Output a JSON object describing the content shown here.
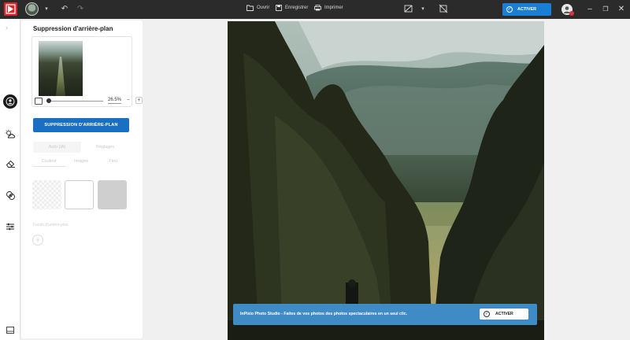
{
  "toolbar": {
    "open_label": "Ouvrir",
    "save_label": "Enregistrer",
    "print_label": "Imprimer",
    "activate_label": "ACTIVER",
    "icons": [
      "app-logo-icon",
      "undo-icon",
      "redo-icon",
      "folder-icon",
      "save-icon",
      "print-icon",
      "compare-icon",
      "crop-toggle-icon",
      "user-icon",
      "minimize-icon",
      "restore-icon",
      "close-icon"
    ]
  },
  "rail": {
    "items": [
      "portrait-icon",
      "weather-icon",
      "eraser-icon",
      "effects-icon",
      "adjustments-icon",
      "gallery-icon"
    ],
    "active": "portrait-icon"
  },
  "panel": {
    "title": "Suppression d'arrière-plan",
    "zoom_value": "26.5%",
    "remove_bg_label": "SUPPRESSION D'ARRIÈRE-PLAN",
    "tabs": [
      "Auto (IA)",
      "Réglages"
    ],
    "subtabs": [
      "Couleur",
      "Images",
      "Flou"
    ],
    "custom_label": "Fonds d'arrière-plan"
  },
  "banner": {
    "text": "InPixio Photo Studio - Faites de vos photos des photos spectaculaires en un seul clic.",
    "button_label": "ACTIVER"
  },
  "colors": {
    "accent": "#1a7fd4",
    "button": "#1a6fc2",
    "banner": "#3f8bc6",
    "topbar": "#2b2b2b"
  }
}
